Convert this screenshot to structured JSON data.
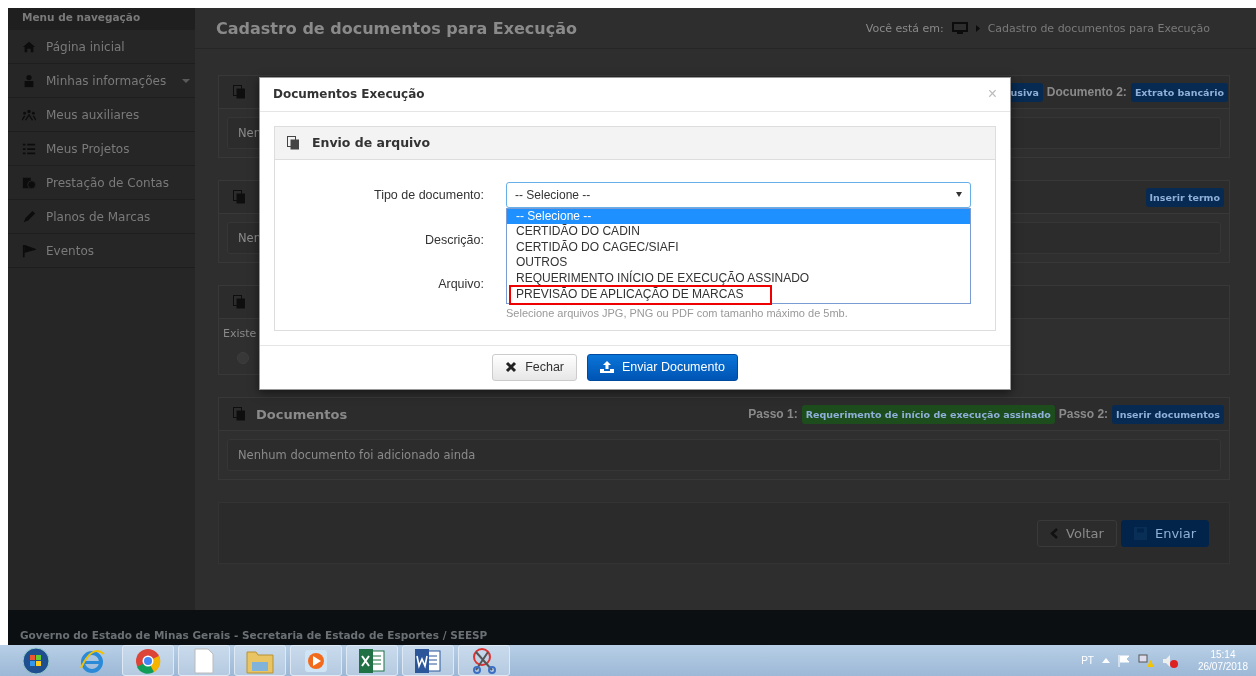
{
  "sidebar": {
    "title": "Menu de navegação",
    "items": [
      {
        "label": "Página inicial",
        "has_submenu": false
      },
      {
        "label": "Minhas informações",
        "has_submenu": true
      },
      {
        "label": "Meus auxiliares",
        "has_submenu": false
      },
      {
        "label": "Meus Projetos",
        "has_submenu": false
      },
      {
        "label": "Prestação de Contas",
        "has_submenu": false
      },
      {
        "label": "Planos de Marcas",
        "has_submenu": false
      },
      {
        "label": "Eventos",
        "has_submenu": false
      }
    ]
  },
  "header": {
    "title": "Cadastro de documentos para Execução",
    "breadcrumb_label": "Você está em:",
    "breadcrumb_current": "Cadastro de documentos para Execução"
  },
  "panels": [
    {
      "actions": [
        {
          "kind": "button",
          "label": "usiva",
          "color": "#062a52"
        },
        {
          "kind": "label",
          "label": "Documento 2:"
        },
        {
          "kind": "button",
          "label": "Extrato bancário",
          "color": "#062a52"
        }
      ],
      "body_text": "Nen"
    },
    {
      "actions": [
        {
          "kind": "button",
          "label": "Inserir termo",
          "color": "#062a52"
        }
      ],
      "body_text": "Nen"
    },
    {
      "body_text": "Existe",
      "radio_selected": false
    },
    {
      "title": "Documentos",
      "actions": [
        {
          "kind": "label",
          "label": "Passo 1:"
        },
        {
          "kind": "button",
          "label": "Requerimento de início de execução assinado",
          "color": "#1d4d1d"
        },
        {
          "kind": "label",
          "label": "Passo 2:"
        },
        {
          "kind": "button",
          "label": "Inserir documentos",
          "color": "#062a52"
        }
      ],
      "body_text": "Nenhum documento foi adicionado ainda"
    }
  ],
  "form_actions": [
    {
      "kind": "back",
      "label": "Voltar"
    },
    {
      "kind": "save",
      "label": "Enviar"
    }
  ],
  "footer": "Governo do Estado de Minas Gerais - Secretaria de Estado de Esportes / SEESP",
  "modal": {
    "title": "Documentos Execução",
    "close": "×",
    "panel_title": "Envio de arquivo",
    "fields": [
      {
        "kind": "select",
        "label": "Tipo de documento:",
        "value": "-- Selecione --",
        "expanded": true,
        "options": [
          {
            "label": "-- Selecione --",
            "selected": true,
            "highlighted": false
          },
          {
            "label": "CERTIDÃO DO CADIN",
            "selected": false,
            "highlighted": false
          },
          {
            "label": "CERTIDÃO DO CAGEC/SIAFI",
            "selected": false,
            "highlighted": false
          },
          {
            "label": "OUTROS",
            "selected": false,
            "highlighted": false
          },
          {
            "label": "REQUERIMENTO INÍCIO DE EXECUÇÃO ASSINADO",
            "selected": false,
            "highlighted": false
          },
          {
            "label": "PREVISÃO DE APLICAÇÃO DE MARCAS",
            "selected": false,
            "highlighted": true
          }
        ]
      },
      {
        "kind": "text",
        "label": "Descrição:"
      },
      {
        "kind": "file",
        "label": "Arquivo:",
        "hint": "Selecione arquivos JPG, PNG ou PDF com tamanho máximo de 5mb."
      }
    ],
    "buttons": [
      {
        "kind": "close",
        "label": "Fechar"
      },
      {
        "kind": "upload",
        "label": "Enviar Documento"
      }
    ]
  },
  "tray": {
    "language": "PT",
    "time": "15:14",
    "date": "26/07/2018"
  }
}
